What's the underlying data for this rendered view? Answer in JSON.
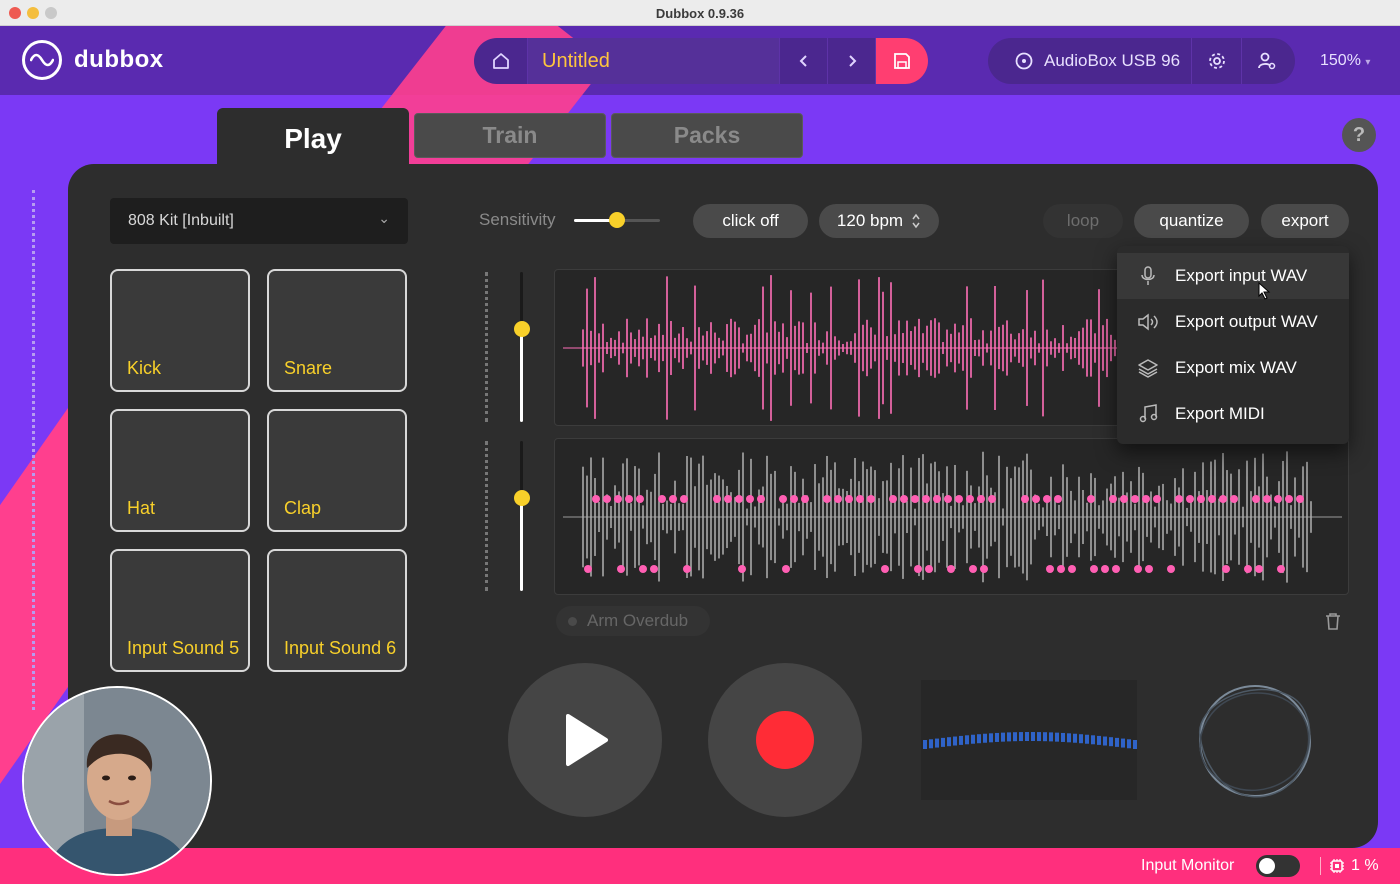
{
  "window": {
    "title": "Dubbox 0.9.36"
  },
  "app": {
    "name": "dubbox"
  },
  "nav": {
    "project_title": "Untitled"
  },
  "device": {
    "name": "AudioBox USB 96",
    "zoom": "150%"
  },
  "tabs": [
    {
      "label": "Play",
      "active": true
    },
    {
      "label": "Train",
      "active": false
    },
    {
      "label": "Packs",
      "active": false
    }
  ],
  "help_label": "?",
  "kit": {
    "selected": "808 Kit [Inbuilt]"
  },
  "pads": [
    "Kick",
    "Snare",
    "Hat",
    "Clap",
    "Input Sound 5",
    "Input Sound 6"
  ],
  "toolbar": {
    "sensitivity_label": "Sensitivity",
    "sensitivity_level": 0.5,
    "click": "click off",
    "bpm": "120 bpm",
    "loop": "loop",
    "quantize": "quantize",
    "export": "export"
  },
  "export_menu": [
    {
      "label": "Export input WAV",
      "icon": "microphone-icon"
    },
    {
      "label": "Export output WAV",
      "icon": "speaker-icon"
    },
    {
      "label": "Export mix WAV",
      "icon": "layers-icon"
    },
    {
      "label": "Export MIDI",
      "icon": "music-note-icon"
    }
  ],
  "arm_overdub": "Arm Overdub",
  "lane_levels": {
    "top": 0.62,
    "bottom": 0.62
  },
  "status": {
    "input_monitor": "Input Monitor",
    "cpu": "1 %"
  },
  "colors": {
    "accent_yellow": "#f8d02a",
    "pink": "#ff3f8e",
    "purple": "#7b39f5",
    "record_red": "#ff2c36"
  }
}
